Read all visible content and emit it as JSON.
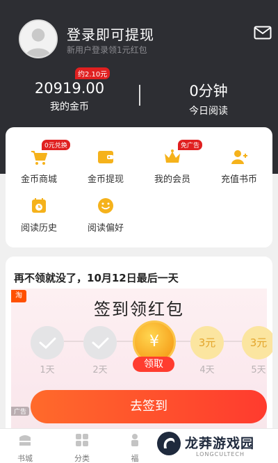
{
  "header": {
    "login_title": "登录即可提现",
    "login_subtitle": "新用户登录领1元红包",
    "coin_badge": "约2.10元",
    "coins_value": "20919.00",
    "coins_label": "我的金币",
    "reading_value": "0分钟",
    "reading_label": "今日阅读"
  },
  "menu": [
    {
      "label": "金币商城",
      "icon": "cart-icon",
      "badge": "0元兑换"
    },
    {
      "label": "金币提现",
      "icon": "wallet-icon"
    },
    {
      "label": "我的会员",
      "icon": "crown-icon",
      "badge": "免广告"
    },
    {
      "label": "充值书币",
      "icon": "add-user-icon"
    },
    {
      "label": "阅读历史",
      "icon": "calendar-clock-icon"
    },
    {
      "label": "阅读偏好",
      "icon": "smile-icon"
    }
  ],
  "signin": {
    "headline": "再不领就没了，10月12日最后一天",
    "taobao_tag": "淘",
    "ad_title": "签到领红包",
    "today_symbol": "¥",
    "claim_label": "领取",
    "steps": [
      {
        "day": "1天",
        "state": "done"
      },
      {
        "day": "2天",
        "state": "done"
      },
      {
        "day": "",
        "state": "today"
      },
      {
        "day": "4天",
        "amount": "3元",
        "state": "coin"
      },
      {
        "day": "5天",
        "amount": "3元",
        "state": "coin"
      }
    ],
    "button_label": "去签到",
    "ad_label": "广告"
  },
  "bottom_nav": [
    {
      "label": "书城",
      "icon": "bookstore-icon"
    },
    {
      "label": "分类",
      "icon": "category-icon"
    },
    {
      "label": "福",
      "icon": "welfare-icon"
    }
  ],
  "watermark": {
    "title": "龙莽游戏园",
    "subtitle": "LONGCULTECH"
  },
  "colors": {
    "header_bg": "#2d2e33",
    "accent_red": "#e02020",
    "button_orange": "#ff4e2d",
    "icon_yellow": "#f5b21b"
  }
}
